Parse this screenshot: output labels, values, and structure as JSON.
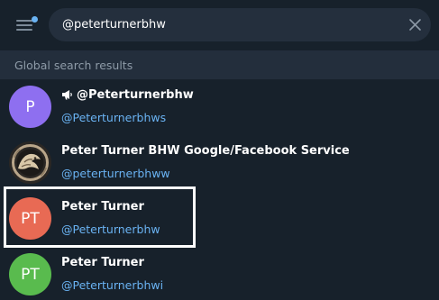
{
  "search": {
    "value": "@peterturnerbhw",
    "placeholder": "Search"
  },
  "section": {
    "label": "Global search results"
  },
  "results": [
    {
      "avatar_initials": "P",
      "avatar_color": "#8e6ff0",
      "is_channel": true,
      "title": "@Peterturnerbhw",
      "username": "@Peterturnerbhws"
    },
    {
      "avatar_initials": "",
      "avatar_image": "ornate-brass-dragon-emblem",
      "is_channel": false,
      "title": "Peter Turner BHW Google/Facebook Service",
      "username": "@peterturnerbhww"
    },
    {
      "avatar_initials": "PT",
      "avatar_color": "#e86a54",
      "is_channel": false,
      "title": "Peter Turner",
      "username": "@Peterturnerbhw",
      "highlighted": true
    },
    {
      "avatar_initials": "PT",
      "avatar_color": "#59bb4e",
      "is_channel": false,
      "title": "Peter Turner",
      "username": "@Peterturnerbhwi"
    }
  ],
  "colors": {
    "background": "#17212b",
    "search_field": "#242f3d",
    "section_bg": "#232e3c",
    "accent": "#6ab3f3",
    "muted": "#8e9ba8"
  },
  "icons": {
    "menu": "hamburger-menu-icon",
    "unread_dot": "notification-dot-icon",
    "clear": "close-icon",
    "channel": "megaphone-icon"
  }
}
